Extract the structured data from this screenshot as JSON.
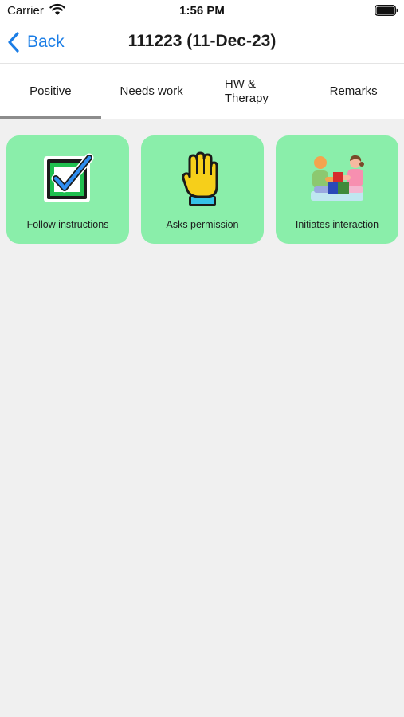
{
  "status_bar": {
    "carrier": "Carrier",
    "time": "1:56 PM",
    "icons": [
      "wifi-icon",
      "battery-icon"
    ]
  },
  "nav": {
    "back_label": "Back",
    "title": "111223 (11-Dec-23)",
    "accent_color": "#1a7de6"
  },
  "tabs": [
    {
      "label": "Positive",
      "selected": true
    },
    {
      "label": "Needs work",
      "selected": false
    },
    {
      "label": "HW & Therapy",
      "selected": false
    },
    {
      "label": "Remarks",
      "selected": false
    }
  ],
  "cards": [
    {
      "label": "Follow instructions",
      "icon": "checkbox-icon"
    },
    {
      "label": "Asks permission",
      "icon": "raised-hand-icon"
    },
    {
      "label": "Initiates interaction",
      "icon": "kids-playing-blocks-icon"
    }
  ],
  "colors": {
    "card_background": "#8aeeaa",
    "page_background": "#f0f0f0",
    "tab_indicator": "#8c8c8c"
  }
}
